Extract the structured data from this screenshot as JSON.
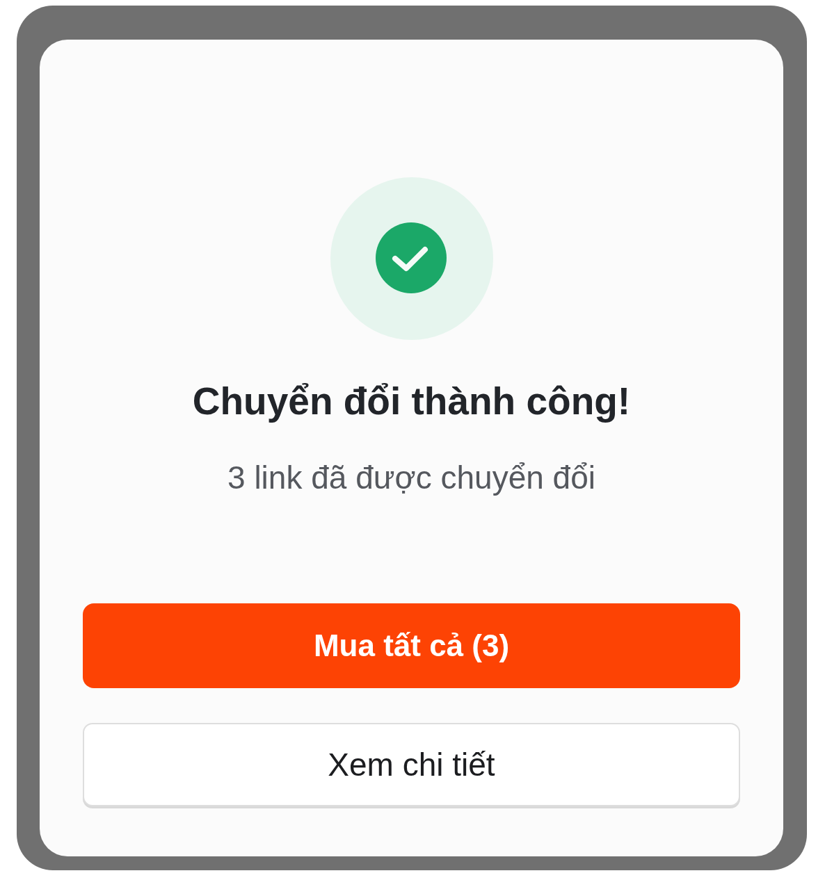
{
  "dialog": {
    "title": "Chuyển đổi thành công!",
    "message": "3 link đã được chuyển đổi",
    "buttons": [
      {
        "label": "Mua tất cả (3)",
        "kind": "primary"
      },
      {
        "label": "Xem chi tiết",
        "kind": "secondary"
      }
    ]
  }
}
